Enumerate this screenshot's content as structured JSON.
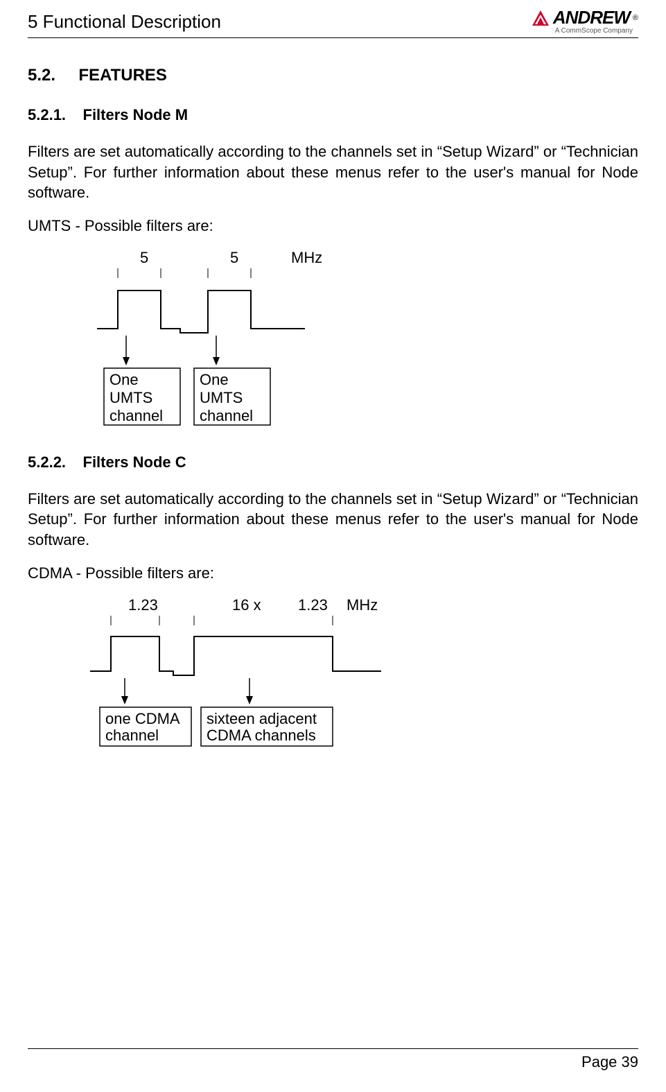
{
  "header": {
    "chapter": "5 Functional Description",
    "logo": {
      "brand": "ANDREW",
      "tagline": "A CommScope Company",
      "dot_color": "#d4002a"
    }
  },
  "sections": {
    "s52": {
      "num": "5.2.",
      "title": "FEATURES"
    },
    "s521": {
      "num": "5.2.1.",
      "title": "Filters Node M",
      "para": "Filters are set automatically according to the channels set in “Setup Wizard” or “Technician Setup”. For further information about these menus refer to the user's manual for Node software.",
      "filters_line": "UMTS - Possible filters are:"
    },
    "s522": {
      "num": "5.2.2.",
      "title": "Filters Node C",
      "para": "Filters are set automatically according to the channels set in “Setup Wizard” or “Technician Setup”. For further information about these menus refer to the user's manual for Node software.",
      "filters_line": "CDMA - Possible filters are:"
    }
  },
  "diagram_umts": {
    "w1": "5",
    "w2": "5",
    "unit": "MHz",
    "label1_l1": "One",
    "label1_l2": "UMTS",
    "label1_l3": "channel",
    "label2_l1": "One",
    "label2_l2": "UMTS",
    "label2_l3": "channel"
  },
  "diagram_cdma": {
    "w1": "1.23",
    "mult": "16 x",
    "w2": "1.23",
    "unit": "MHz",
    "label1_l1": "one CDMA",
    "label1_l2": "channel",
    "label2_l1": "sixteen adjacent",
    "label2_l2": "CDMA channels"
  },
  "footer": {
    "page": "Page 39"
  }
}
